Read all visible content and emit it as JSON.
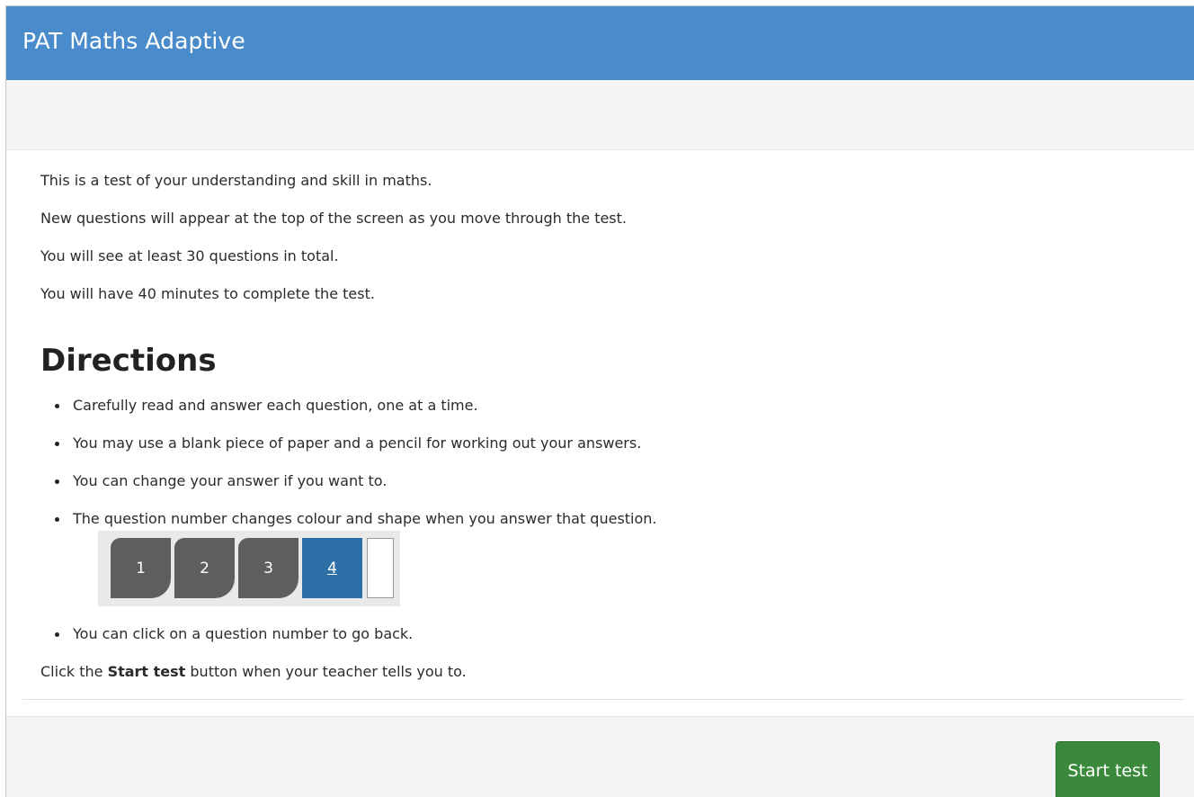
{
  "header": {
    "title": "PAT Maths Adaptive"
  },
  "intro": [
    "This is a test of your understanding and skill in maths.",
    "New questions will appear at the top of the screen as you move through the test.",
    "You will see at least 30 questions in total.",
    "You will have 40 minutes to complete the test."
  ],
  "directions": {
    "heading": "Directions",
    "items": [
      "Carefully read and answer each question, one at a time.",
      "You may use a blank piece of paper and a pencil for working out your answers.",
      "You can change your answer if you want to.",
      "The question number changes colour and shape when you answer that question.",
      "You can click on a question number to go back."
    ],
    "example_tabs": [
      {
        "label": "1",
        "state": "answered"
      },
      {
        "label": "2",
        "state": "answered"
      },
      {
        "label": "3",
        "state": "answered"
      },
      {
        "label": "4",
        "state": "current"
      },
      {
        "label": "",
        "state": "unanswered"
      }
    ]
  },
  "instruction": {
    "prefix": "Click the ",
    "bold": "Start test",
    "suffix": " button when your teacher tells you to."
  },
  "footer": {
    "start_label": "Start test"
  },
  "colors": {
    "header_bg": "#4a8ccb",
    "answered_tab": "#5e5e5e",
    "current_tab": "#2f6fa8",
    "start_button": "#3b8a3c"
  }
}
